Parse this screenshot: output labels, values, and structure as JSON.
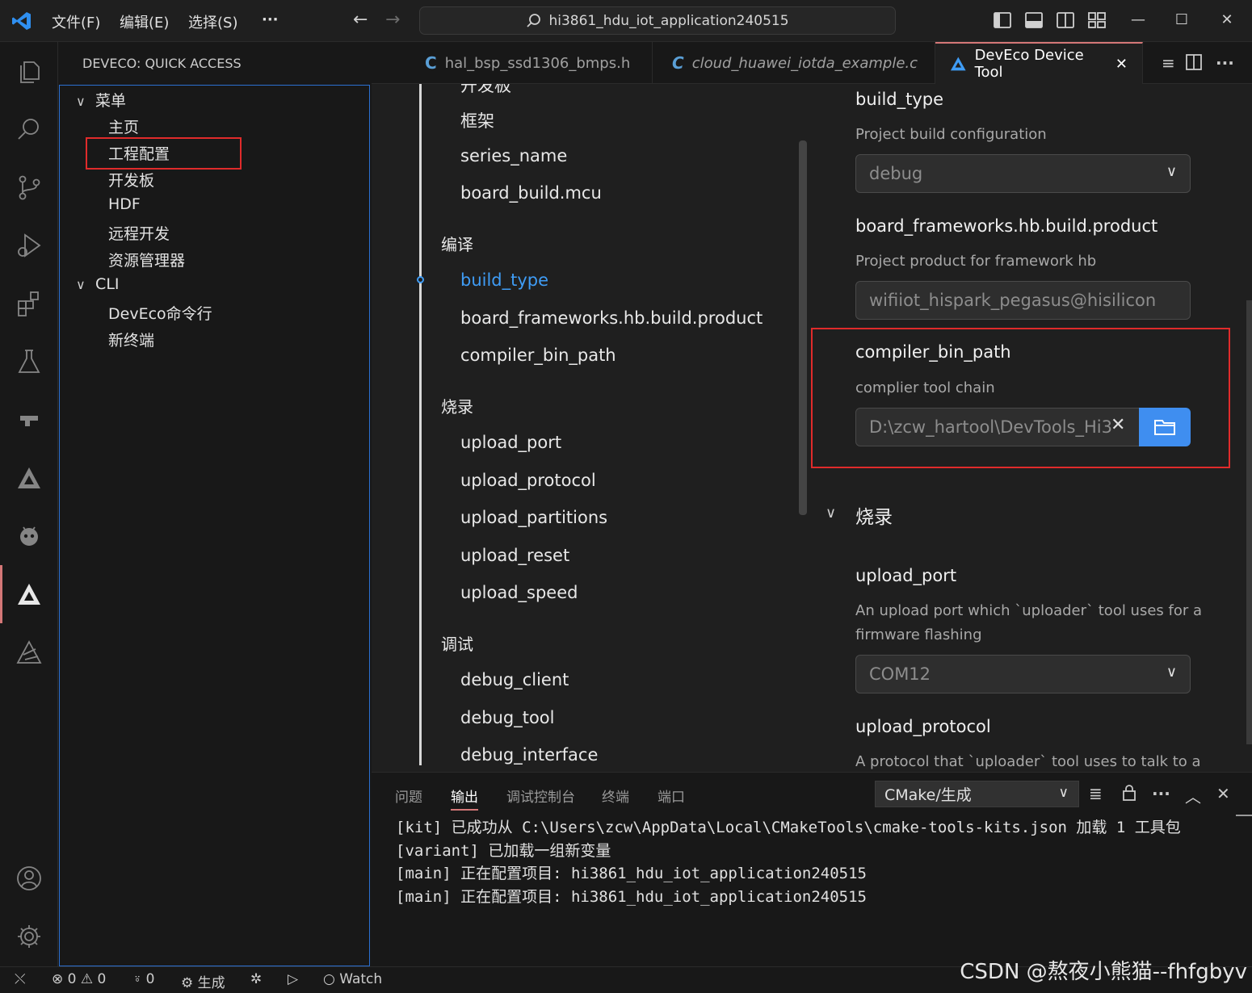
{
  "titlebar": {
    "menus": [
      "文件(F)",
      "编辑(E)",
      "选择(S)",
      "···"
    ],
    "search_text": "hi3861_hdu_iot_application240515",
    "icons": [
      "toggle-primary-sidebar-icon",
      "toggle-panel-icon",
      "toggle-secondary-sidebar-icon",
      "customize-layout-icon",
      "minimize-icon",
      "maximize-icon",
      "close-icon"
    ]
  },
  "sidebar": {
    "title": "DEVECO: QUICK ACCESS",
    "groups": [
      {
        "label": "菜单",
        "items": [
          "主页",
          "工程配置",
          "开发板",
          "HDF",
          "远程开发",
          "资源管理器"
        ]
      },
      {
        "label": "CLI",
        "items": [
          "DevEco命令行",
          "新终端"
        ]
      }
    ]
  },
  "tabs": [
    {
      "prefix": "C",
      "label": "hal_bsp_ssd1306_bmps.h"
    },
    {
      "prefix": "C",
      "label": "cloud_huawei_iotda_example.c"
    },
    {
      "label": "DevEco Device Tool",
      "close": "✕"
    }
  ],
  "toc": {
    "cut_top": "开发板",
    "items": [
      "框架",
      "series_name",
      "board_build.mcu"
    ],
    "sections": [
      {
        "label": "编译",
        "items": [
          "build_type",
          "board_frameworks.hb.build.product",
          "compiler_bin_path"
        ]
      },
      {
        "label": "烧录",
        "items": [
          "upload_port",
          "upload_protocol",
          "upload_partitions",
          "upload_reset",
          "upload_speed"
        ]
      },
      {
        "label": "调试",
        "items": [
          "debug_client",
          "debug_tool",
          "debug_interface"
        ]
      }
    ],
    "active": "build_type"
  },
  "settings": {
    "build_type": {
      "title": "build_type",
      "desc": "Project build configuration",
      "value": "debug"
    },
    "product": {
      "title": "board_frameworks.hb.build.product",
      "desc": "Project product for framework hb",
      "value": "wifiiot_hispark_pegasus@hisilicon"
    },
    "compiler": {
      "title": "compiler_bin_path",
      "desc": "complier tool chain",
      "value": "D:\\zcw_hartool\\DevTools_Hi3"
    },
    "burn_section": "烧录",
    "upload_port": {
      "title": "upload_port",
      "desc": "An upload port which `uploader` tool uses for a firmware flashing",
      "value": "COM12"
    },
    "upload_protocol": {
      "title": "upload_protocol",
      "desc": "A protocol that `uploader` tool uses to talk to a"
    }
  },
  "panel": {
    "tabs": [
      "问题",
      "输出",
      "调试控制台",
      "终端",
      "端口"
    ],
    "active_tab": "输出",
    "channel": "CMake/生成",
    "lines": [
      "[kit] 已成功从 C:\\Users\\zcw\\AppData\\Local\\CMakeTools\\cmake-tools-kits.json 加载 1 工具包",
      "[variant] 已加载一组新变量",
      "[main] 正在配置项目: hi3861_hdu_iot_application240515",
      "[main] 正在配置项目: hi3861_hdu_iot_application240515"
    ]
  },
  "status": {
    "errors": "0",
    "warnings": "0",
    "ports": "0",
    "build": "生成",
    "watch": "Watch"
  },
  "watermark": "CSDN @熬夜小熊猫--fhfgbyv"
}
